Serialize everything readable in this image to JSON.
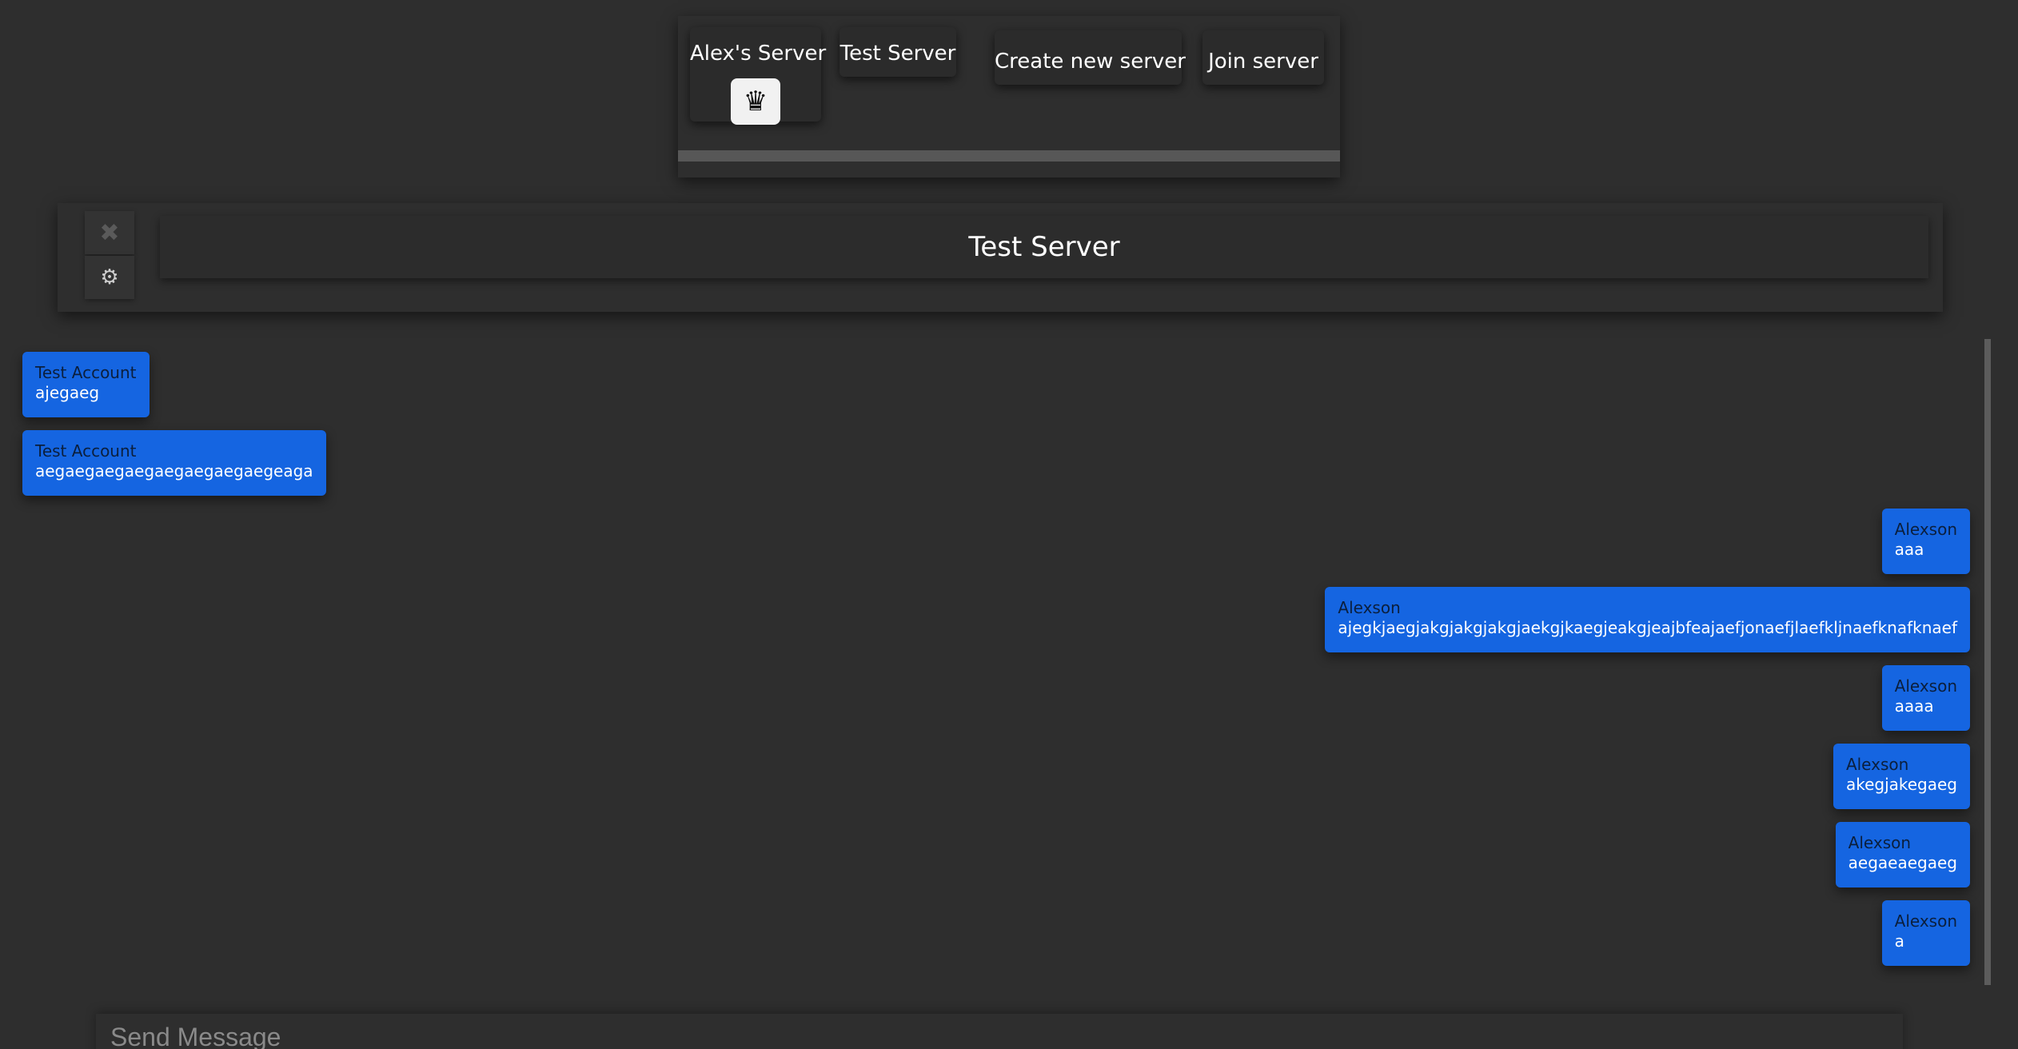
{
  "server_bar": {
    "servers": [
      {
        "label": "Alex's Server",
        "owner_icon": "crown-icon"
      },
      {
        "label": "Test Server"
      }
    ],
    "create_label": "Create new server",
    "join_label": "Join server"
  },
  "channel_header": {
    "title": "Test Server",
    "close_icon": "close-icon",
    "settings_icon": "gear-icon"
  },
  "messages": [
    {
      "author": "Test Account",
      "text": "ajegaeg",
      "side": "left"
    },
    {
      "author": "Test Account",
      "text": "aegaegaegaegaegaegaegaegeaga",
      "side": "left"
    },
    {
      "author": "Alexson",
      "text": "aaa",
      "side": "right"
    },
    {
      "author": "Alexson",
      "text": "ajegkjaegjakgjakgjakgjaekgjkaegjeakgjeajbfeajaefjonaefjlaefkljnaefknafknaef",
      "side": "right"
    },
    {
      "author": "Alexson",
      "text": "aaaa",
      "side": "right"
    },
    {
      "author": "Alexson",
      "text": "akegjakegaeg",
      "side": "right"
    },
    {
      "author": "Alexson",
      "text": "aegaeaegaeg",
      "side": "right"
    },
    {
      "author": "Alexson",
      "text": "a",
      "side": "right"
    }
  ],
  "composer": {
    "placeholder": "Send Message"
  },
  "colors": {
    "background": "#2e2e2e",
    "message_bubble": "#1565e1",
    "author_text": "#0b1f3d"
  }
}
